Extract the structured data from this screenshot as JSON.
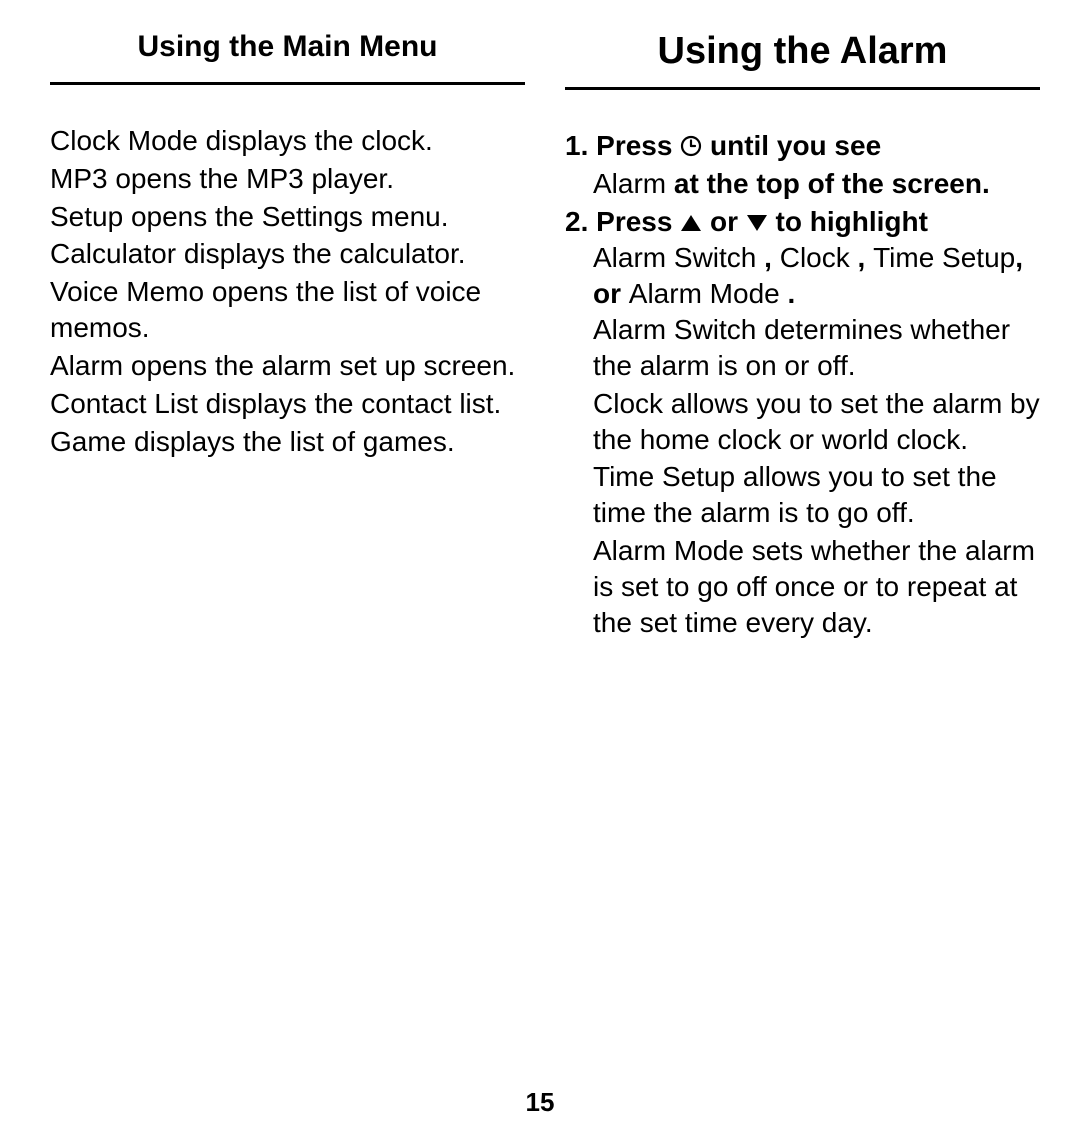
{
  "left": {
    "header": "Using the Main Menu",
    "paragraphs": [
      "Clock Mode displays the clock.",
      "MP3 opens the MP3 player.",
      "Setup opens the Settings menu.",
      "Calculator displays the calculator.",
      "Voice Memo opens the list of voice memos.",
      "Alarm opens the alarm set up screen.",
      "Contact List displays the contact list.",
      "Game displays the list of games."
    ]
  },
  "right": {
    "header": "Using the Alarm",
    "step1": {
      "num": "1.",
      "pre": "Press ",
      "mid1": " until you see ",
      "alarm": "Alarm",
      "mid2": " at the top of the screen."
    },
    "step2": {
      "num": "2.",
      "pre": "Press ",
      "or": " or ",
      "post": " to highlight ",
      "line2a": "Alarm Switch ",
      "c1": ", ",
      "line2b": "Clock ",
      "c2": ", ",
      "line2c": "Time Setup",
      "c3": ", or ",
      "line2d": "Alarm Mode ",
      "c4": "."
    },
    "after": [
      "Alarm Switch determines whether the alarm is on or off.",
      "Clock allows you to set the alarm by the home clock or world clock.",
      "Time Setup allows you to set the time the alarm is to go off.",
      "Alarm Mode sets whether the alarm is set to go off once or to repeat at the set time every day."
    ]
  },
  "pageNumber": "15"
}
